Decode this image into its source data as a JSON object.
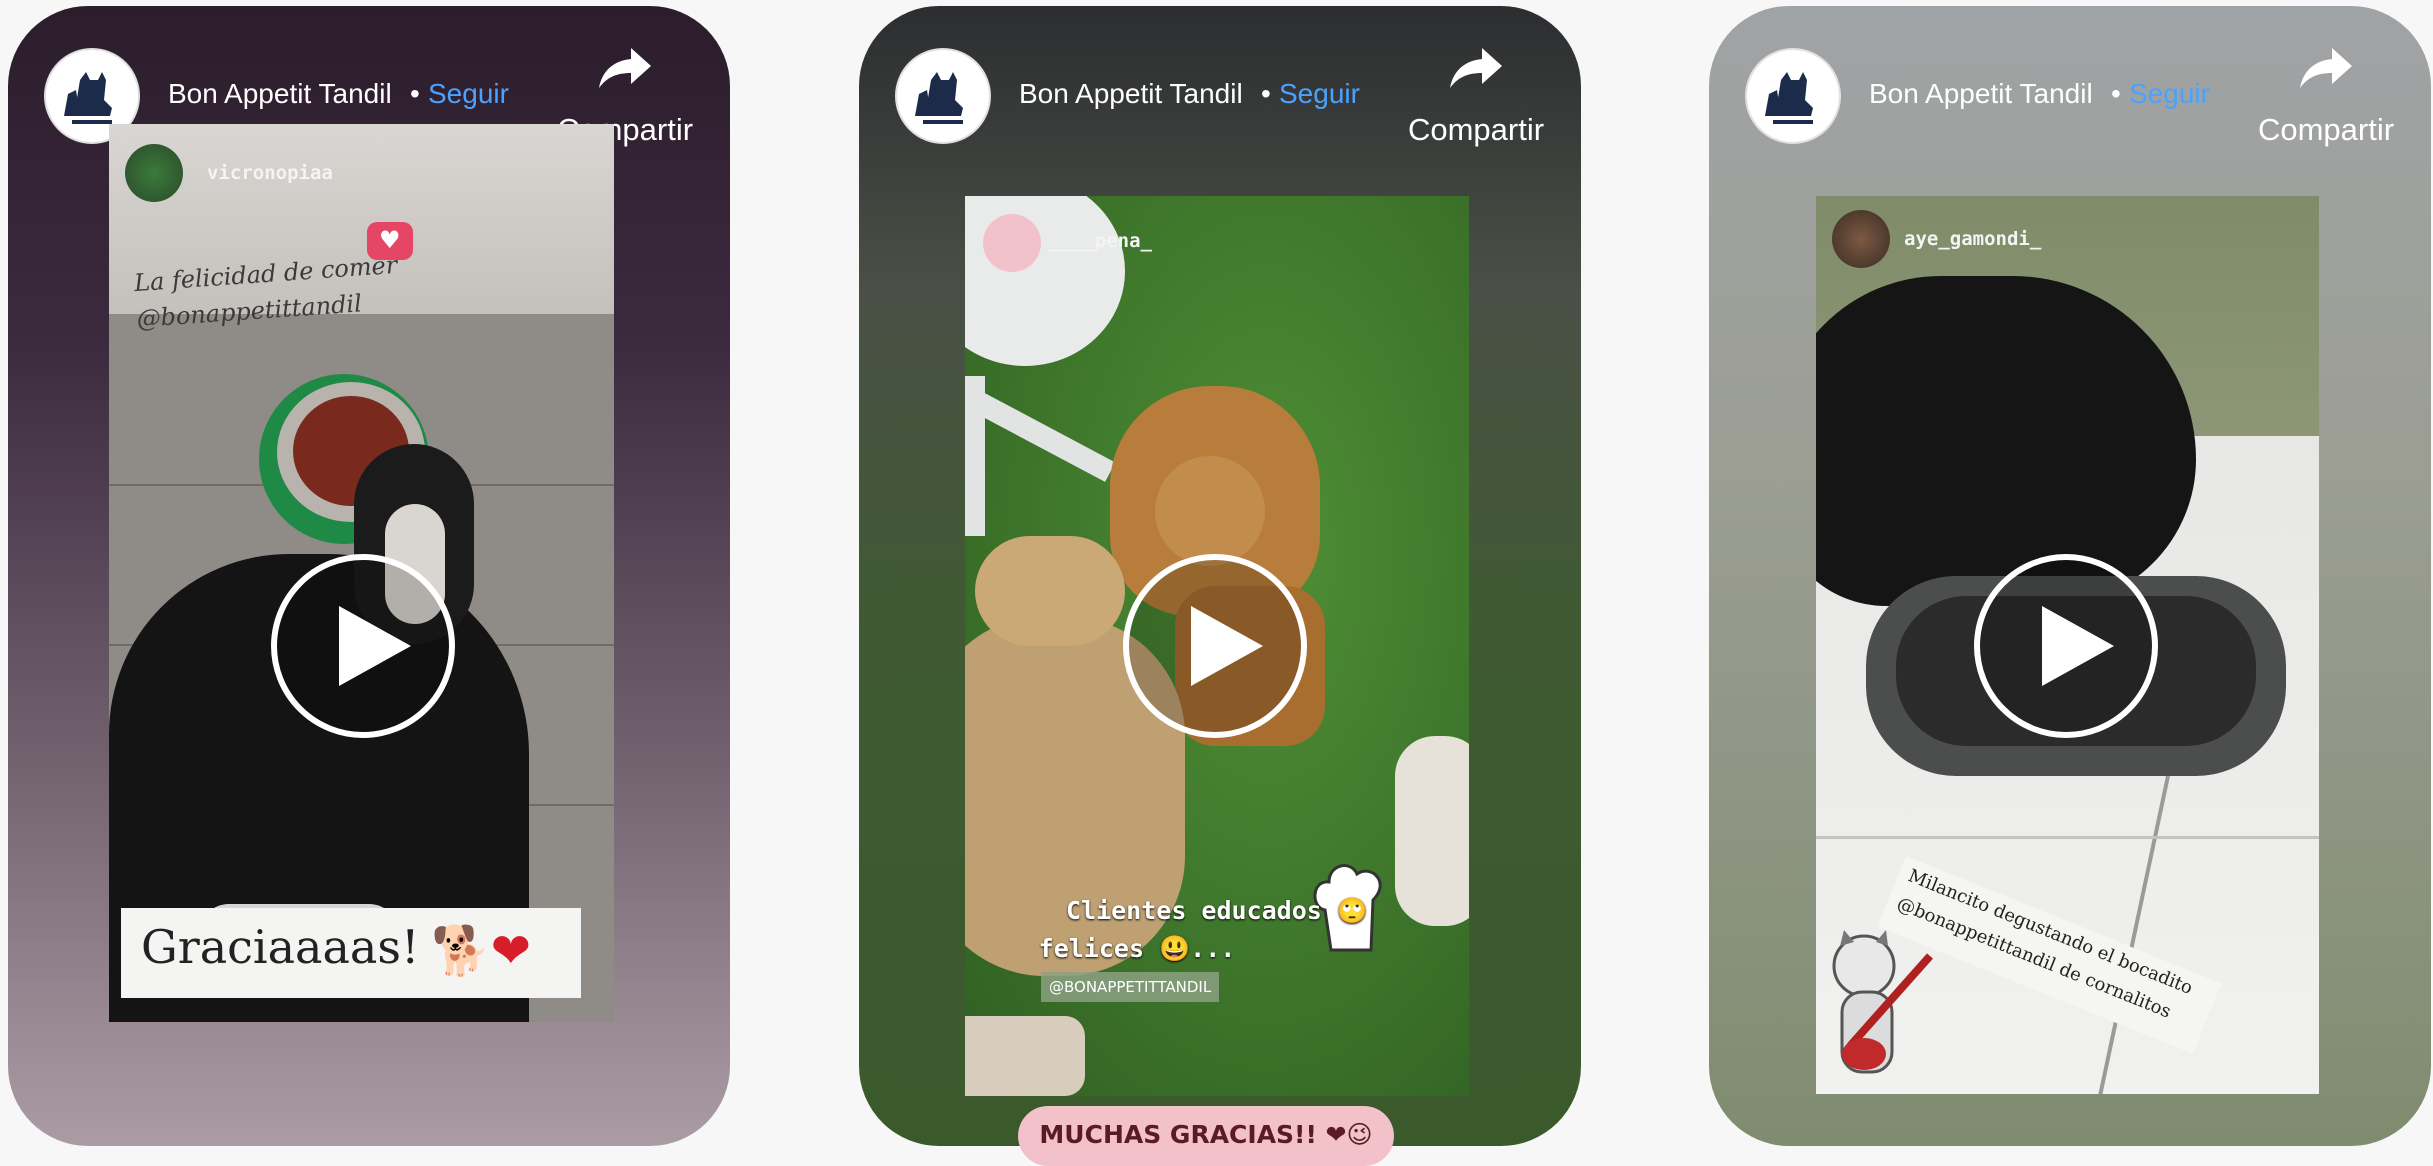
{
  "account": {
    "name": "Bon Appetit Tandil",
    "separator": "•",
    "follow_label": "Seguir",
    "avatar_icon": "dog-cat-logo-icon"
  },
  "share_label": "Compartir",
  "share_icon": "share-arrow-icon",
  "play_icon": "play-icon",
  "videos": [
    {
      "story_user": "vicronopiaa",
      "caption_handwritten": "La felicidad de comer @bonappetittandil",
      "sticker_text": "Graciaaaas!",
      "sticker_emojis": "🐕❤"
    },
    {
      "story_user": "____pena_",
      "caption_line1": "Clientes educados 🙄",
      "caption_line2": "felices 😃...",
      "tag": "@BONAPPETITTANDIL",
      "bottom_banner": "MUCHAS GRACIAS!! ❤😉"
    },
    {
      "story_user": "aye_gamondi_",
      "caption_line1": "Milancito degustando el bocadito",
      "caption_line2": "@bonappetittandil  de cornalitos"
    }
  ]
}
